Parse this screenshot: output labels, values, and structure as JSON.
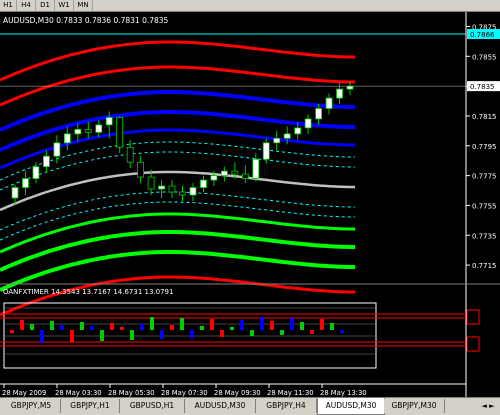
{
  "toolbar": {
    "timeframes": [
      "H1",
      "H4",
      "D1",
      "W1",
      "MN"
    ]
  },
  "chart": {
    "title": "AUDUSD,M30  0.7833 0.7836 0.7831 0.7835",
    "current_price_label": "0.7835",
    "highlight_price_label": "0.7866",
    "colors": {
      "background": "#000000",
      "bull_candle": "#ffffff",
      "bear_candle": "#000000",
      "candle_outline": "#00cc00",
      "red_band": "#ff0000",
      "blue_band": "#0000ff",
      "green_band": "#00ff00",
      "middle_line": "#c0c0c0",
      "aqua_line": "#00ffff"
    }
  },
  "chart_data": {
    "type": "candlestick",
    "symbol": "AUDUSD",
    "timeframe": "M30",
    "ohlc_header": [
      0.7833,
      0.7836,
      0.7831,
      0.7835
    ],
    "y_ticks": [
      "0.7875",
      "0.7855",
      "0.7835",
      "0.7815",
      "0.7795",
      "0.7775",
      "0.7755",
      "0.7735",
      "0.7715"
    ],
    "ylim": [
      0.7705,
      0.7878
    ],
    "candles": [
      [
        0.776,
        0.7769,
        0.7755,
        0.7767
      ],
      [
        0.7767,
        0.7778,
        0.7762,
        0.7773
      ],
      [
        0.7773,
        0.7784,
        0.777,
        0.7781
      ],
      [
        0.7781,
        0.7792,
        0.7777,
        0.7788
      ],
      [
        0.7788,
        0.7802,
        0.7783,
        0.7797
      ],
      [
        0.7797,
        0.7808,
        0.7792,
        0.7803
      ],
      [
        0.7803,
        0.781,
        0.7798,
        0.7806
      ],
      [
        0.7806,
        0.7811,
        0.78,
        0.7804
      ],
      [
        0.7804,
        0.7812,
        0.7801,
        0.7809
      ],
      [
        0.7809,
        0.7818,
        0.78,
        0.7814
      ],
      [
        0.7814,
        0.7815,
        0.779,
        0.7794
      ],
      [
        0.7794,
        0.7799,
        0.778,
        0.7784
      ],
      [
        0.7784,
        0.7788,
        0.777,
        0.7774
      ],
      [
        0.7774,
        0.7779,
        0.7762,
        0.7766
      ],
      [
        0.7766,
        0.7772,
        0.776,
        0.7768
      ],
      [
        0.7768,
        0.7772,
        0.776,
        0.7764
      ],
      [
        0.7764,
        0.7768,
        0.7758,
        0.7762
      ],
      [
        0.7762,
        0.777,
        0.7758,
        0.7767
      ],
      [
        0.7767,
        0.7775,
        0.7764,
        0.7772
      ],
      [
        0.7772,
        0.7778,
        0.7768,
        0.7775
      ],
      [
        0.7775,
        0.7781,
        0.7771,
        0.7778
      ],
      [
        0.7778,
        0.7784,
        0.7773,
        0.7776
      ],
      [
        0.7776,
        0.7782,
        0.777,
        0.7773
      ],
      [
        0.7773,
        0.779,
        0.7771,
        0.7786
      ],
      [
        0.7786,
        0.78,
        0.7783,
        0.7797
      ],
      [
        0.7797,
        0.7805,
        0.7792,
        0.78
      ],
      [
        0.78,
        0.7808,
        0.7796,
        0.7803
      ],
      [
        0.7803,
        0.7811,
        0.7799,
        0.7807
      ],
      [
        0.7807,
        0.7816,
        0.7803,
        0.7813
      ],
      [
        0.7813,
        0.7823,
        0.7809,
        0.782
      ],
      [
        0.782,
        0.783,
        0.7816,
        0.7827
      ],
      [
        0.7827,
        0.7837,
        0.7823,
        0.7833
      ],
      [
        0.7833,
        0.7838,
        0.7829,
        0.7835
      ]
    ],
    "x_tick_labels": [
      "28 May 2009",
      "28 May 03:30",
      "28 May 05:30",
      "28 May 07:30",
      "28 May 09:30",
      "28 May 11:30",
      "28 May 13:30"
    ]
  },
  "indicator": {
    "title": "OANFXTIMER  14.3543 13.7167 14.6731 13.0791",
    "values": [
      14.3543,
      13.7167,
      14.6731,
      13.0791
    ]
  },
  "tabs": [
    {
      "label": "GBPJPY,M5",
      "active": false
    },
    {
      "label": "GBPJPY,H1",
      "active": false
    },
    {
      "label": "GBPUSD,H1",
      "active": false
    },
    {
      "label": "AUDUSD,M30",
      "active": false
    },
    {
      "label": "GBPJPY,H4",
      "active": false
    },
    {
      "label": "AUDUSD,M30",
      "active": true
    },
    {
      "label": "GBPJPY,M30",
      "active": false
    }
  ],
  "tab_nav_label": "◄ ►"
}
